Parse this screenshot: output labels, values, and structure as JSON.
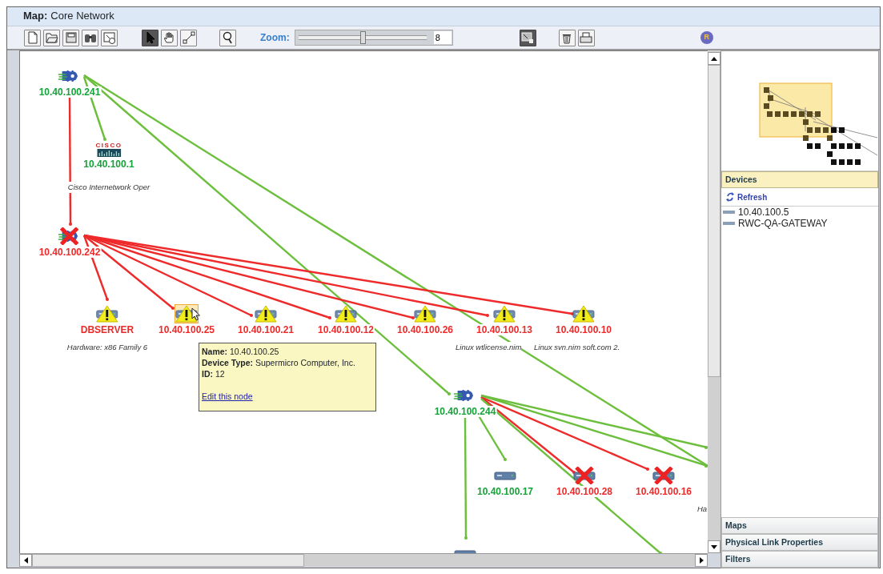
{
  "window": {
    "title_label": "Map:",
    "title": "Core Network"
  },
  "toolbar": {
    "left_tools": [
      {
        "kind": "new",
        "selected": false
      },
      {
        "kind": "open",
        "selected": false
      },
      {
        "kind": "save",
        "selected": false
      },
      {
        "kind": "find",
        "selected": false
      },
      {
        "kind": "export",
        "selected": false
      },
      {
        "kind": "pointer",
        "selected": true
      },
      {
        "kind": "hand",
        "selected": false
      },
      {
        "kind": "connect",
        "selected": false
      },
      {
        "kind": "magnify",
        "selected": false
      }
    ],
    "zoom_label": "Zoom:",
    "zoom": {
      "level": 0.5,
      "value": "8"
    },
    "right_tools": [
      {
        "kind": "lock",
        "selected": true
      },
      {
        "kind": "delete",
        "selected": false
      },
      {
        "kind": "print",
        "selected": false
      }
    ],
    "badge": "R"
  },
  "map": {
    "nodes": [
      {
        "label": "10.40.100.241",
        "kind": "router",
        "highlighted": false
      },
      {
        "label": "10.40.100.1",
        "kind": "cisco",
        "logo_text": "CISCO",
        "description": "Cisco Internetwork Oper",
        "highlighted": false
      },
      {
        "label": "10.40.100.242",
        "kind": "router_down",
        "highlighted": false
      },
      {
        "label": "DBSERVER",
        "kind": "server_warning",
        "description": "Hardware: x86 Family 6",
        "highlighted": false
      },
      {
        "label": "10.40.100.25",
        "kind": "server_warning",
        "highlighted": true
      },
      {
        "label": "10.40.100.21",
        "kind": "server_warning",
        "highlighted": false
      },
      {
        "label": "10.40.100.12",
        "kind": "server_warning",
        "highlighted": false
      },
      {
        "label": "10.40.100.26",
        "kind": "server_warning",
        "highlighted": false
      },
      {
        "label": "10.40.100.13",
        "kind": "server_warning",
        "description": "Linux wtlicense.nim",
        "highlighted": false
      },
      {
        "label": "10.40.100.10",
        "kind": "server_warning",
        "description": "Linux svn.nim soft.com  2.",
        "highlighted": false
      },
      {
        "label": "10.40.100.244",
        "kind": "router",
        "highlighted": false
      },
      {
        "label": "10.40.100.17",
        "kind": "server",
        "highlighted": false
      },
      {
        "label": "10.40.100.28",
        "kind": "server_down",
        "highlighted": false
      },
      {
        "label": "10.40.100.16",
        "kind": "server_down",
        "description": "Ha",
        "highlighted": false
      },
      {
        "kind": "server",
        "highlighted": false
      }
    ],
    "links": [
      {
        "down": false
      },
      {
        "down": true
      },
      {
        "down": false
      },
      {
        "down": false
      },
      {
        "down": true
      },
      {
        "down": true
      },
      {
        "down": true
      },
      {
        "down": true
      },
      {
        "down": true
      },
      {
        "down": true
      },
      {
        "down": true
      },
      {
        "down": false
      },
      {
        "down": false
      },
      {
        "down": true
      },
      {
        "down": true
      },
      {
        "down": false
      },
      {
        "down": false
      },
      {
        "down": false
      }
    ],
    "tooltip": {
      "lines": [
        "**Name:** 10.40.100.25",
        "**Device Type:** Supermicro Computer, Inc.",
        "**ID:** 12"
      ],
      "link": "Edit this node"
    }
  },
  "side_panel": {
    "sections": [
      {
        "title": "Devices",
        "expanded": true,
        "refresh": "Refresh",
        "items": [
          "10.40.100.5",
          "RWC-QA-GATEWAY"
        ]
      },
      {
        "title": "Maps",
        "expanded": false
      },
      {
        "title": "Physical Link Properties",
        "expanded": false
      },
      {
        "title": "Filters",
        "expanded": false
      }
    ]
  }
}
